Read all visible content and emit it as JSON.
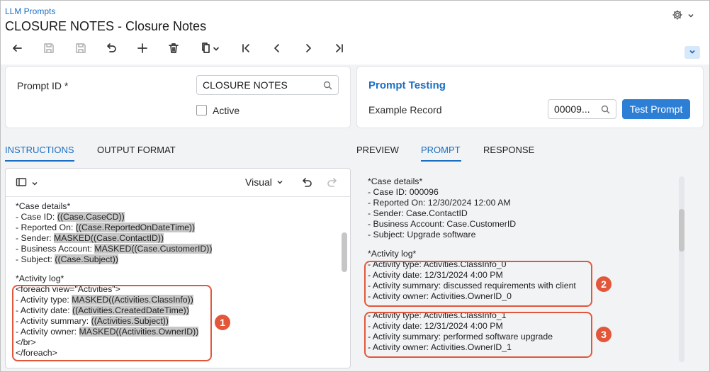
{
  "header": {
    "breadcrumb": "LLM Prompts",
    "title": "CLOSURE NOTES - Closure Notes"
  },
  "toolbar": {
    "buttons": [
      "back-icon",
      "save-close-icon",
      "save-icon",
      "undo-icon",
      "add-icon",
      "delete-icon",
      "copy-paste-icon",
      "first-icon",
      "previous-icon",
      "next-icon",
      "last-icon"
    ]
  },
  "summary": {
    "prompt_id_label": "Prompt ID *",
    "prompt_id_value": "CLOSURE NOTES",
    "active_label": "Active"
  },
  "testing": {
    "title": "Prompt Testing",
    "example_record_label": "Example Record",
    "example_record_value": "00009...",
    "test_button": "Test Prompt"
  },
  "left_tabs": [
    "INSTRUCTIONS",
    "OUTPUT FORMAT"
  ],
  "right_tabs": [
    "PREVIEW",
    "PROMPT",
    "RESPONSE"
  ],
  "editor": {
    "mode": "Visual",
    "lines": [
      [
        {
          "t": "*Case details*"
        }
      ],
      [
        {
          "t": "- Case ID: "
        },
        {
          "t": "((Case.CaseCD))",
          "hl": true
        }
      ],
      [
        {
          "t": "- Reported On: "
        },
        {
          "t": "((Case.ReportedOnDateTime))",
          "hl": true
        }
      ],
      [
        {
          "t": "- Sender: "
        },
        {
          "t": "MASKED((Case.ContactID))",
          "hl": true
        }
      ],
      [
        {
          "t": "- Business Account: "
        },
        {
          "t": "MASKED((Case.CustomerID))",
          "hl": true
        }
      ],
      [
        {
          "t": "- Subject: "
        },
        {
          "t": "((Case.Subject))",
          "hl": true
        }
      ],
      [],
      [
        {
          "t": "*Activity log*"
        }
      ],
      [
        {
          "t": "<foreach view=\"Activities\">"
        }
      ],
      [
        {
          "t": "- Activity type: "
        },
        {
          "t": "MASKED((Activities.ClassInfo))",
          "hl": true
        }
      ],
      [
        {
          "t": "- Activity date: "
        },
        {
          "t": "((Activities.CreatedDateTime))",
          "hl": true
        }
      ],
      [
        {
          "t": "- Activity summary: "
        },
        {
          "t": "((Activities.Subject))",
          "hl": true
        }
      ],
      [
        {
          "t": "- Activity owner: "
        },
        {
          "t": "MASKED((Activities.OwnerID))",
          "hl": true
        }
      ],
      [
        {
          "t": "</br>"
        }
      ],
      [
        {
          "t": "</foreach>"
        }
      ]
    ]
  },
  "prompt": {
    "lines": [
      "*Case details*",
      "- Case ID: 000096",
      "- Reported On: 12/30/2024 12:00 AM",
      "- Sender: Case.ContactID",
      "- Business Account: Case.CustomerID",
      "- Subject: Upgrade software",
      "",
      "*Activity log*",
      "- Activity type: Activities.ClassInfo_0",
      "- Activity date: 12/31/2024 4:00 PM",
      "- Activity summary: discussed requirements with client",
      "- Activity owner: Activities.OwnerID_0",
      "",
      "- Activity type: Activities.ClassInfo_1",
      "- Activity date: 12/31/2024 4:00 PM",
      "- Activity summary: performed software upgrade",
      "- Activity owner: Activities.OwnerID_1"
    ]
  },
  "callouts": [
    "1",
    "2",
    "3"
  ],
  "colors": {
    "accent": "#1a6fc2",
    "callout": "#e3563a",
    "highlight": "#c7c7c7"
  }
}
